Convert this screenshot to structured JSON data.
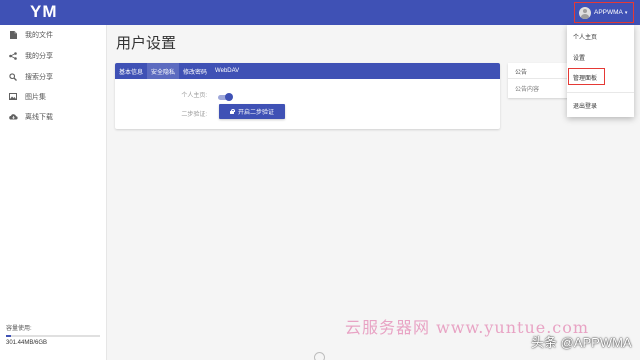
{
  "header": {
    "logo": "YM",
    "user_name": "APPWMA",
    "caret": "▾",
    "accent_color": "#3f51b5",
    "highlight_color": "#e53935"
  },
  "sidebar": {
    "items": [
      {
        "label": "我的文件",
        "icon": "file-icon"
      },
      {
        "label": "我的分享",
        "icon": "share-icon"
      },
      {
        "label": "搜索分享",
        "icon": "search-icon"
      },
      {
        "label": "图片集",
        "icon": "image-icon"
      },
      {
        "label": "离线下载",
        "icon": "cloud-download-icon"
      }
    ],
    "storage": {
      "title": "容量使用:",
      "value": "301.44MB/6GB",
      "used_fraction": 0.049
    }
  },
  "main": {
    "title": "用户设置",
    "tabs": [
      {
        "label": "基本信息",
        "active": false
      },
      {
        "label": "安全隐私",
        "active": true
      },
      {
        "label": "修改密码",
        "active": false
      },
      {
        "label": "WebDAV",
        "active": false
      }
    ],
    "profile_label": "个人主页:",
    "profile_enabled": true,
    "two_factor_label": "二步验证:",
    "two_factor_button": "开启二步验证"
  },
  "notice": {
    "title": "公告",
    "content": "公告内容"
  },
  "dropdown": {
    "items": [
      {
        "label": "个人主页"
      },
      {
        "label": "设置"
      },
      {
        "label": "管理面板",
        "highlighted": true
      },
      {
        "label": "退出登录"
      }
    ]
  },
  "watermark": {
    "text": "云服务器网 www.yuntue.com",
    "credit": "头条 @APPWMA"
  }
}
